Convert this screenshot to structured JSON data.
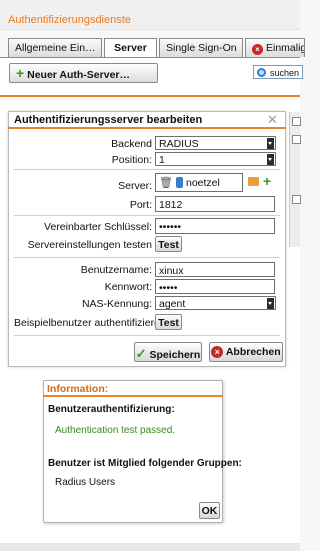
{
  "app": {
    "title": "Authentifizierungsdienste"
  },
  "tabs": [
    {
      "label": "Allgemeine Ein…",
      "active": false
    },
    {
      "label": "Server",
      "active": true
    },
    {
      "label": "Single Sign-On",
      "active": false
    },
    {
      "label": "Einmalige",
      "active": false,
      "icon": "error-icon"
    }
  ],
  "toolbar": {
    "new_button": "Neuer Auth-Server…",
    "search_placeholder": "suchen"
  },
  "dialog": {
    "title": "Authentifizierungsserver bearbeiten",
    "backend_label": "Backend",
    "backend_value": "RADIUS",
    "position_label": "Position:",
    "position_value": "1",
    "server_label": "Server:",
    "server_value": "noetzel",
    "port_label": "Port:",
    "port_value": "1812",
    "secret_label": "Vereinbarter Schlüssel:",
    "secret_value": "••••••",
    "test_settings_label": "Servereinstellungen testen",
    "test_button": "Test",
    "username_label": "Benutzername:",
    "username_value": "xinux",
    "password_label": "Kennwort:",
    "password_value": "•••••",
    "nas_label": "NAS-Kennung:",
    "nas_value": "agent",
    "auth_example_label": "Beispielbenutzer authentifizieren",
    "auth_test_button": "Test",
    "save_button": "Speichern",
    "cancel_button": "Abbrechen"
  },
  "info": {
    "title": "Information:",
    "heading1": "Benutzerauthentifizierung:",
    "result": "Authentication test passed.",
    "heading2": "Benutzer ist Mitglied folgender Gruppen:",
    "group": "Radius Users",
    "ok_button": "OK"
  },
  "colors": {
    "accent": "#e9822a",
    "success_text": "#3a8a1a",
    "error": "#c62828"
  }
}
